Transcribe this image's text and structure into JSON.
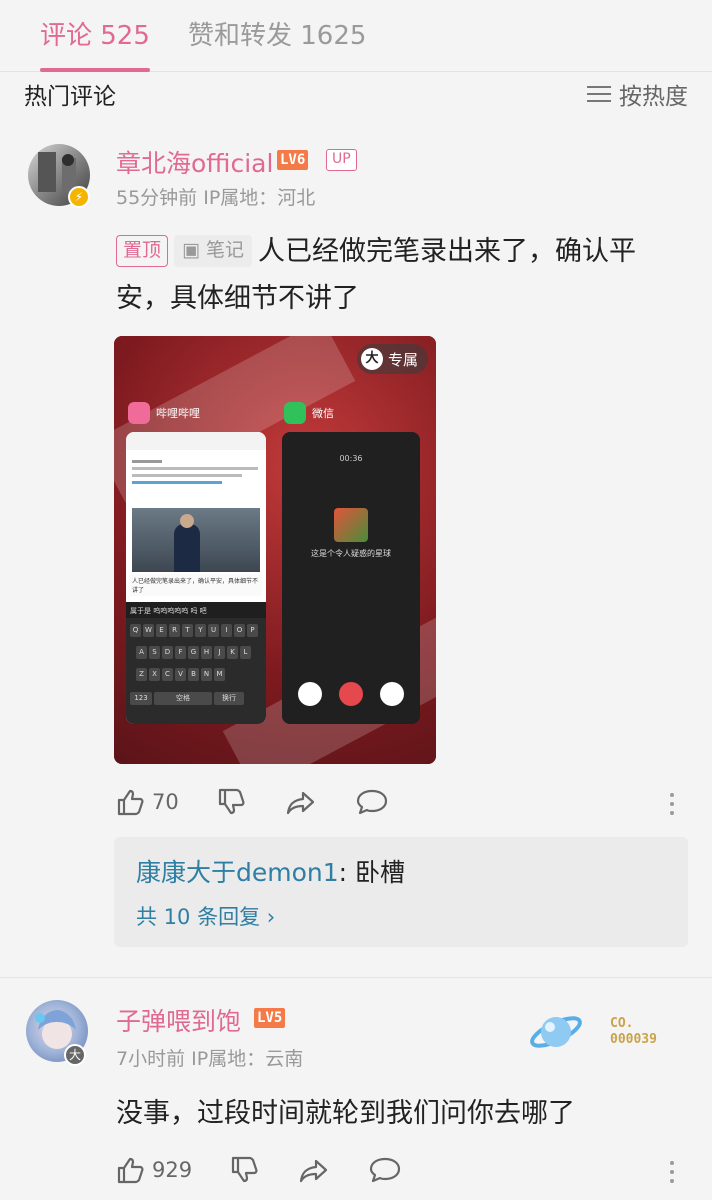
{
  "tabs": {
    "comments": "评论 525",
    "likes_reposts": "赞和转发 1625"
  },
  "section": {
    "title": "热门评论",
    "sort_label": "按热度"
  },
  "comments": [
    {
      "username": "章北海official",
      "level": "LV6",
      "up_badge": "UP",
      "meta": "55分钟前 IP属地：河北",
      "pin_tag": "置顶",
      "note_tag": "笔记",
      "text_line1": "人已经做完笔录出来了，确认平",
      "text_line2": "安，具体细节不讲了",
      "likes": "70",
      "image": {
        "exclusive_badge": "大",
        "exclusive_label": "专属",
        "app1_name": "哔哩哔哩",
        "app2_name": "微信",
        "call_time": "00:36",
        "call_caption": "这是个令人疑惑的星球",
        "reply_input": "人已经做完笔录出来了，确认平安，具体细节不讲了",
        "candidates": "属于是  呜呜呜呜呜  吗  吧",
        "key_space": "空格",
        "key_enter": "换行",
        "key_num": "123"
      },
      "reply": {
        "name": "康康大于demon1",
        "text": "卧槽",
        "more": "共 10 条回复 ›"
      }
    },
    {
      "username": "子弹喂到饱",
      "level": "LV5",
      "meta": "7小时前 IP属地：云南",
      "text": "没事，过段时间就轮到我们问你去哪了",
      "likes": "929",
      "fan_badge_line1": "CO.",
      "fan_badge_line2": "000039"
    }
  ],
  "colors": {
    "accent_pink": "#e06a91",
    "level_orange": "#f47a47",
    "reply_link_blue": "#2f7ea3"
  }
}
